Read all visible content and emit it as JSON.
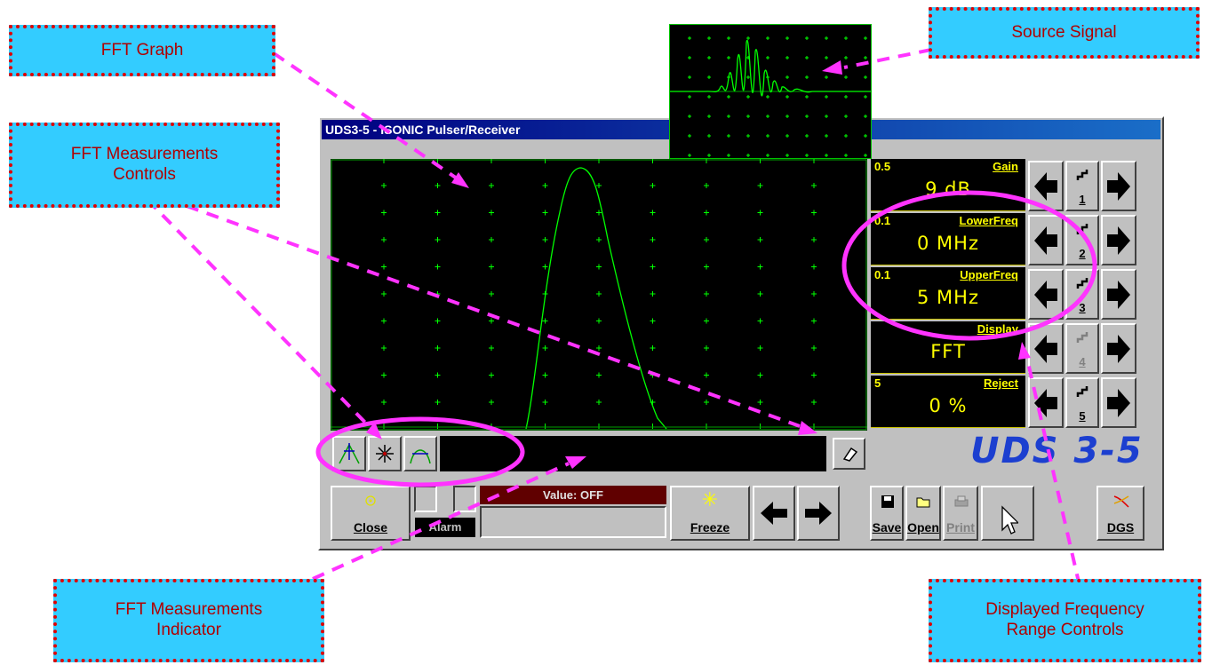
{
  "callouts": {
    "fft_graph": "FFT Graph",
    "source_signal": "Source Signal",
    "fft_measurements_controls": "FFT Measurements\nControls",
    "fft_measurements_indicator": "FFT Measurements\nIndicator",
    "displayed_frequency_range": "Displayed Frequency\nRange Controls"
  },
  "window": {
    "title": "UDS3-5 - ISONIC Pulser/Receiver"
  },
  "controls": [
    {
      "step": "0.5",
      "label": "Gain",
      "value": "9 dB",
      "num": "1"
    },
    {
      "step": "0.1",
      "label": "LowerFreq",
      "value": "0 MHz",
      "num": "2"
    },
    {
      "step": "0.1",
      "label": "UpperFreq",
      "value": "5 MHz",
      "num": "3"
    },
    {
      "step": "",
      "label": "Display",
      "value": "FFT",
      "num": "4"
    },
    {
      "step": "5",
      "label": "Reject",
      "value": "0 %",
      "num": "5"
    }
  ],
  "brand": "UDS 3-5",
  "bottom": {
    "close": "Close",
    "alarm": "Alarm",
    "value_status": "Value: OFF",
    "freeze": "Freeze",
    "save": "Save",
    "open": "Open",
    "print": "Print",
    "dgs": "DGS"
  },
  "icons": {
    "fft_buttons": [
      "peak-marker-icon",
      "cursor-star-icon",
      "bandwidth-marker-icon"
    ],
    "eraser": "eraser-icon"
  },
  "colors": {
    "signal": "#00ff00",
    "grid": "#00ff00",
    "control_text": "#ffff00",
    "highlight": "#ff33ff",
    "brand": "#1c3fd0",
    "callout_bg": "#33ccff",
    "callout_text": "#b00000"
  }
}
